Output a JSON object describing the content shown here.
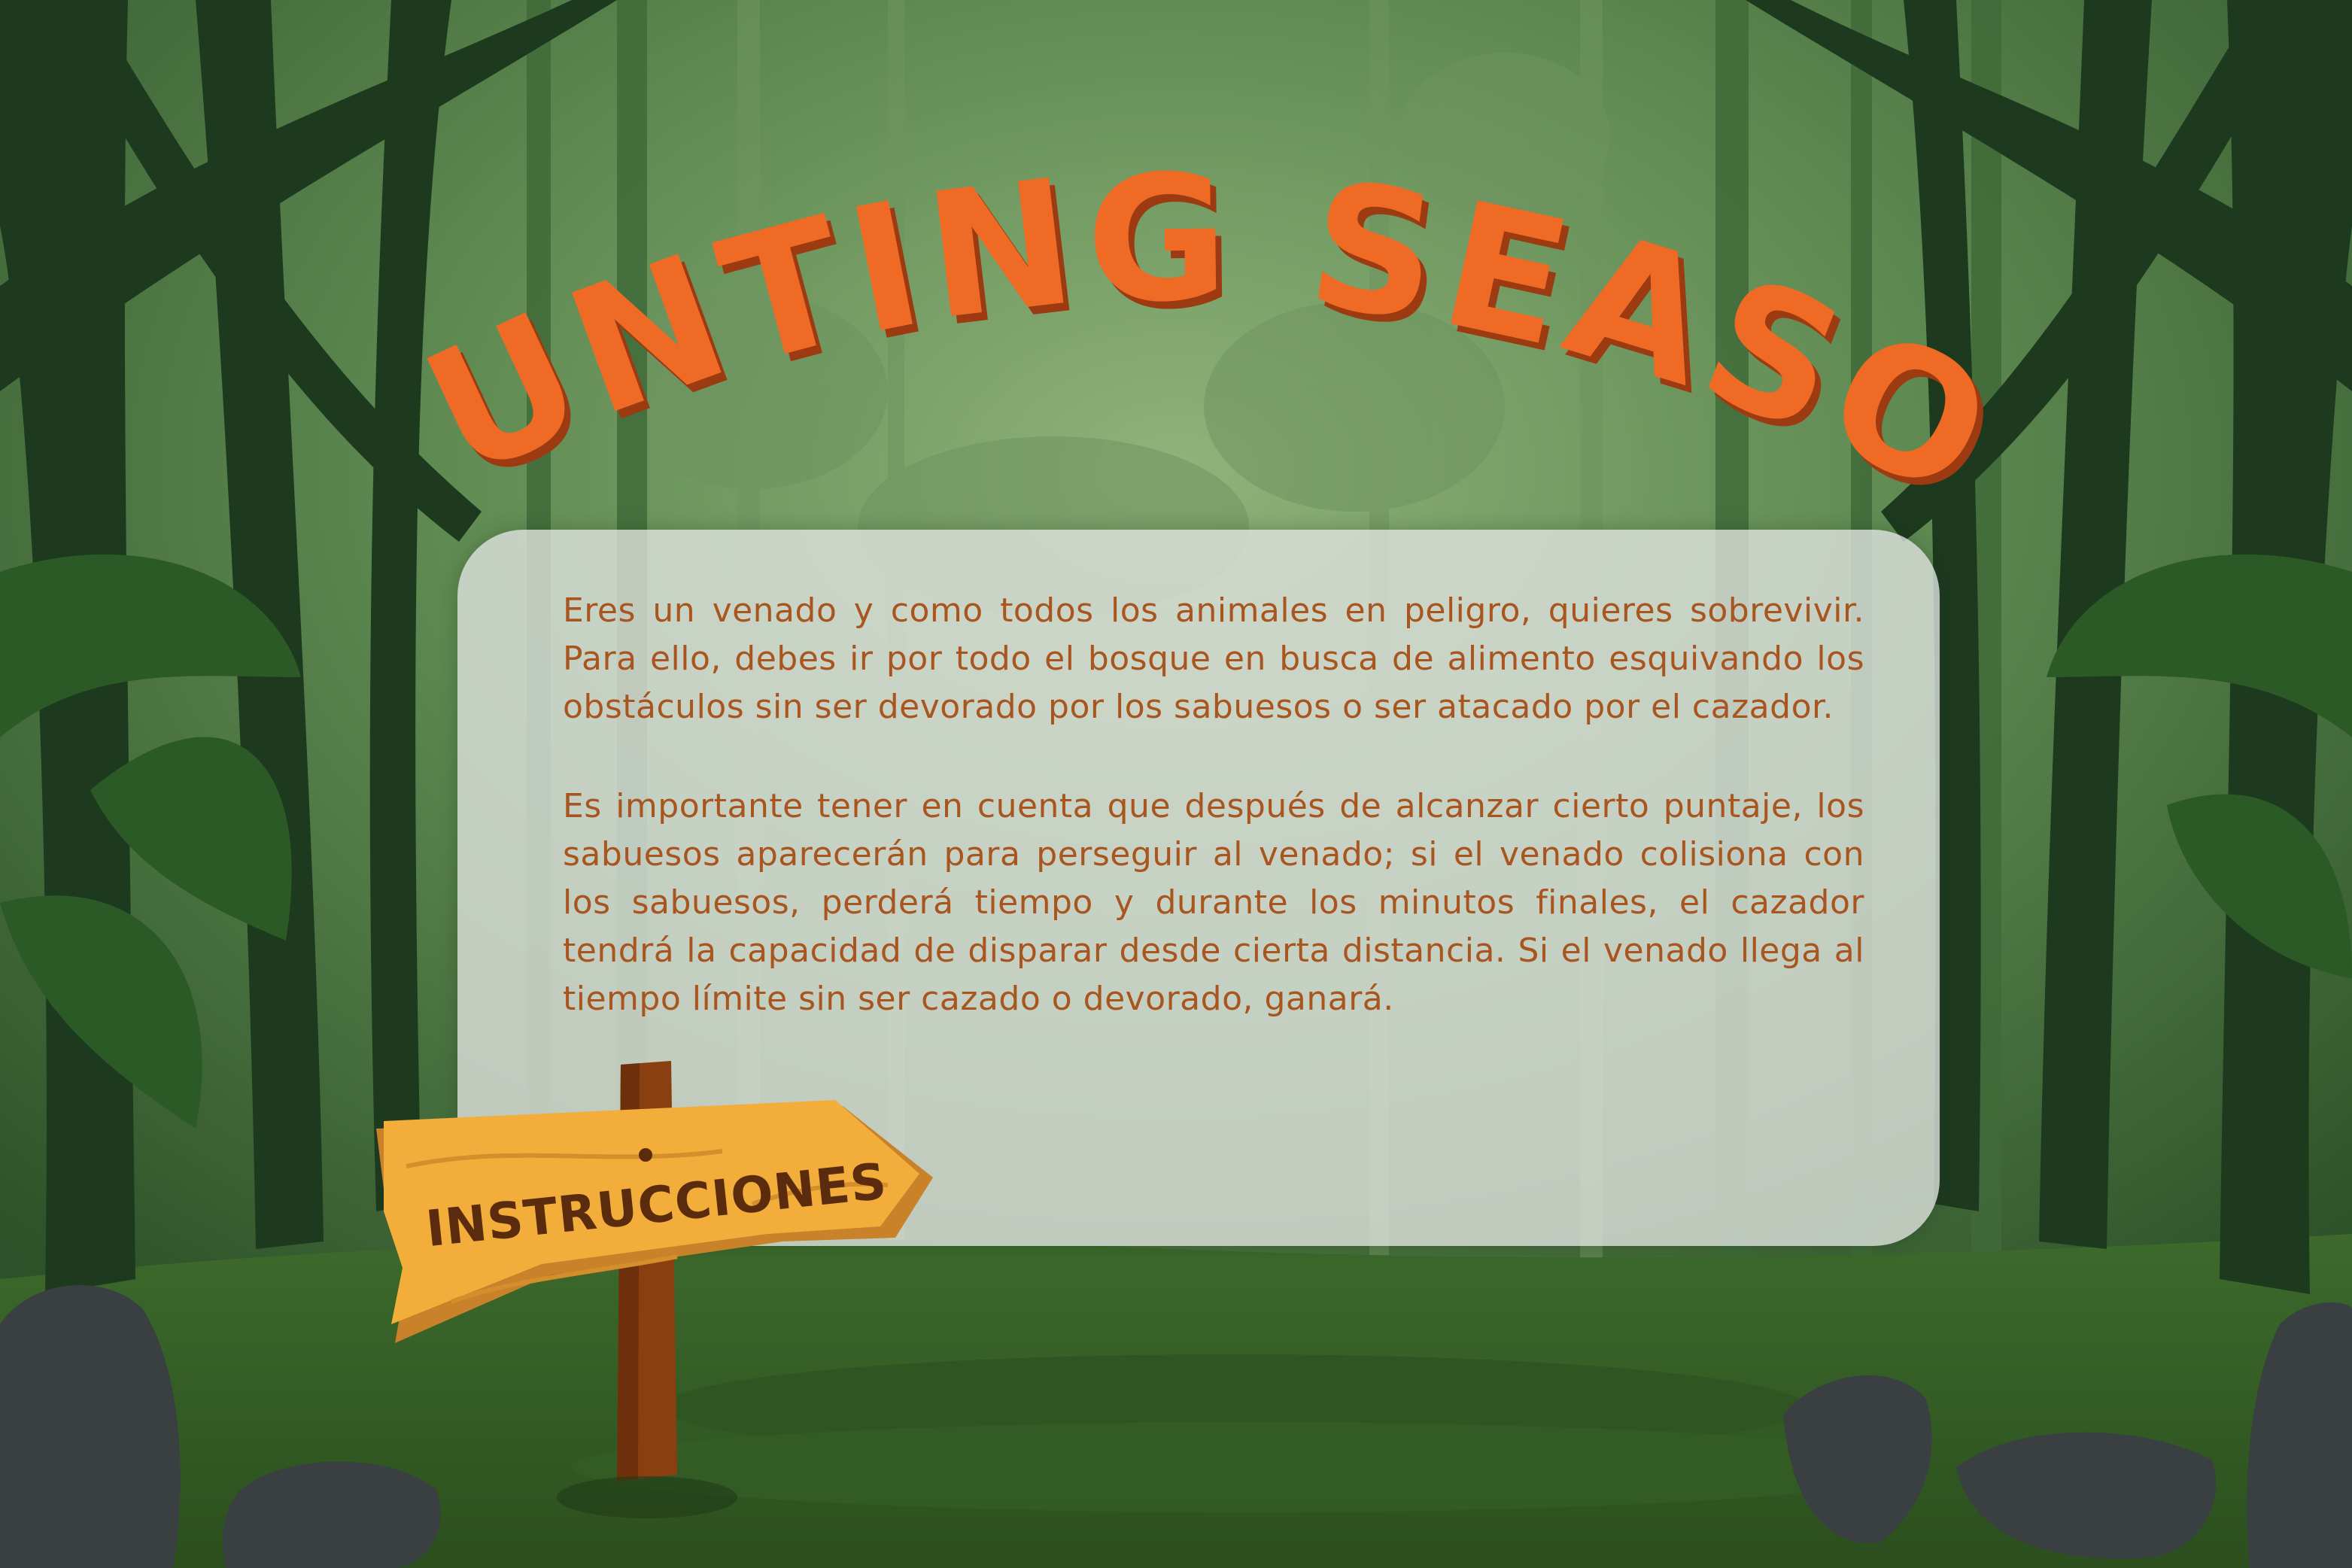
{
  "game": {
    "title": "HUNTING SEASON",
    "colors": {
      "title_fill": "#ef6a25",
      "title_shadow": "#9c3a12",
      "body_text": "#a9551f",
      "panel": "#dfe3df",
      "sign_wood": "#f2ad3a",
      "sign_text": "#5a2c0d"
    }
  },
  "instructions": {
    "paragraph_1": "Eres un venado y como todos los animales en peligro, quieres sobrevivir. Para ello, debes ir por todo el bosque en busca de alimento esquivando los obstáculos sin ser devorado por los sabuesos o ser atacado por el cazador.",
    "paragraph_2": "Es importante tener en cuenta que después de alcanzar cierto puntaje, los sabuesos aparecerán para perseguir al venado; si el venado colisiona con los sabuesos, perderá tiempo y durante los minutos finales, el cazador tendrá la capacidad de disparar desde cierta distancia. Si el venado llega al tiempo límite sin ser cazado o devorado, ganará."
  },
  "sign": {
    "label": "INSTRUCCIONES",
    "icon": "wooden-signpost-icon"
  }
}
